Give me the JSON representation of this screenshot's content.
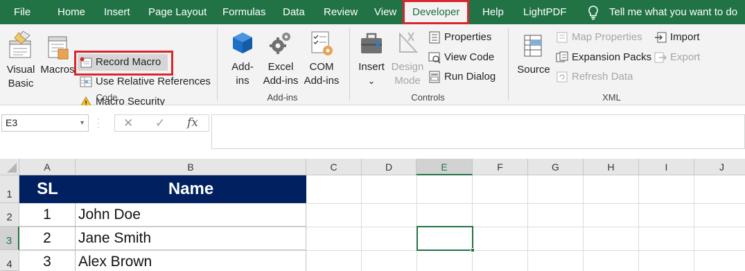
{
  "menu": {
    "items": [
      "File",
      "Home",
      "Insert",
      "Page Layout",
      "Formulas",
      "Data",
      "Review",
      "View",
      "Developer",
      "Help",
      "LightPDF"
    ],
    "tell_me": "Tell me what you want to do",
    "active": "Developer"
  },
  "ribbon": {
    "code": {
      "visual_basic": [
        "Visual",
        "Basic"
      ],
      "macros": "Macros",
      "record_macro": "Record Macro",
      "relative_refs": "Use Relative References",
      "macro_security": "Macro Security",
      "label": "Code"
    },
    "addins": {
      "addins": [
        "Add-",
        "ins"
      ],
      "excel_addins": [
        "Excel",
        "Add-ins"
      ],
      "com_addins": [
        "COM",
        "Add-ins"
      ],
      "label": "Add-ins"
    },
    "controls": {
      "insert": "Insert",
      "insert_arrow": "⌄",
      "design_mode": [
        "Design",
        "Mode"
      ],
      "properties": "Properties",
      "view_code": "View Code",
      "run_dialog": "Run Dialog",
      "label": "Controls"
    },
    "xml": {
      "source": "Source",
      "map_properties": "Map Properties",
      "expansion_packs": "Expansion Packs",
      "refresh_data": "Refresh Data",
      "import": "Import",
      "export": "Export",
      "label": "XML"
    }
  },
  "formula_bar": {
    "name_box": "E3",
    "name_box_arrow": "▾",
    "cancel": "✕",
    "enter": "✓",
    "fx": "fx",
    "value": ""
  },
  "sheet": {
    "columns": [
      "A",
      "B",
      "C",
      "D",
      "E",
      "F",
      "G",
      "H",
      "I",
      "J"
    ],
    "selected_column": "E",
    "rows": [
      "1",
      "2",
      "3",
      "4"
    ],
    "selected_row": "3",
    "headers": {
      "sl": "SL",
      "name": "Name"
    },
    "data": [
      {
        "sl": "1",
        "name": "John Doe"
      },
      {
        "sl": "2",
        "name": "Jane Smith"
      },
      {
        "sl": "3",
        "name": "Alex Brown"
      }
    ],
    "header_fill": "#002060",
    "active_cell": "E3"
  }
}
